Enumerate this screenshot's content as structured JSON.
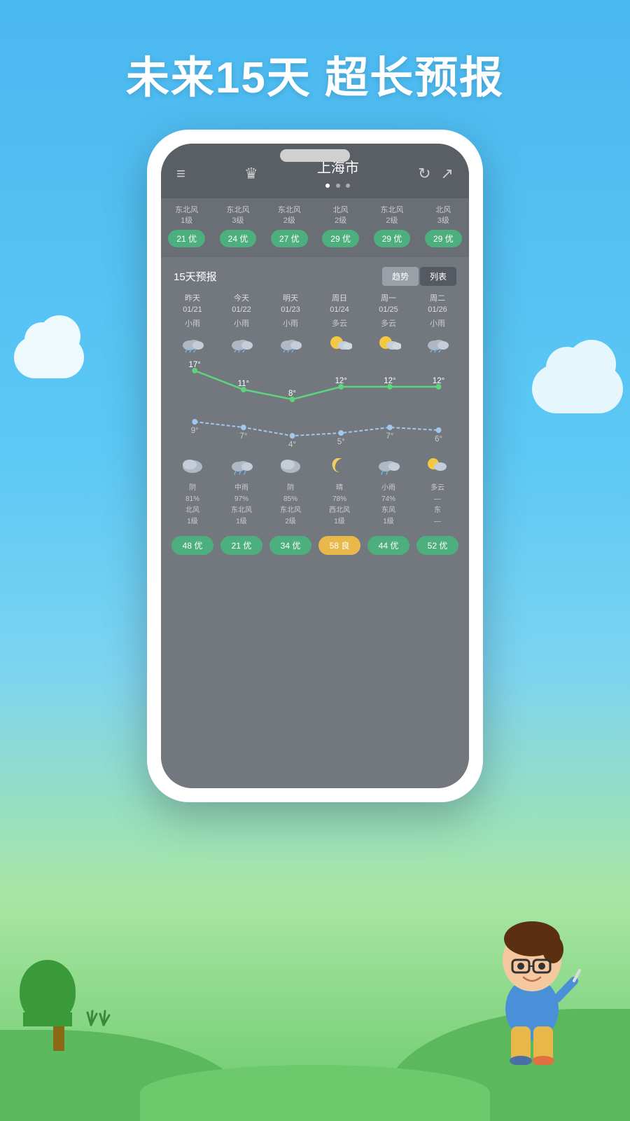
{
  "headline": "未来15天  超长预报",
  "phone": {
    "header": {
      "city": "上海市",
      "menu_icon": "≡",
      "crown_icon": "♛",
      "refresh_icon": "↻",
      "share_icon": "↗"
    },
    "air_quality": [
      {
        "wind": "东北风\n1级",
        "aqi": "21 优",
        "type": "good"
      },
      {
        "wind": "东北风\n3级",
        "aqi": "24 优",
        "type": "good"
      },
      {
        "wind": "东北风\n2级",
        "aqi": "27 优",
        "type": "good"
      },
      {
        "wind": "北风\n2级",
        "aqi": "29 优",
        "type": "good"
      },
      {
        "wind": "东北风\n2级",
        "aqi": "29 优",
        "type": "good"
      },
      {
        "wind": "北风\n3级",
        "aqi": "29 优",
        "type": "good"
      }
    ],
    "forecast_title": "15天预报",
    "forecast_buttons": [
      "趋势",
      "列表"
    ],
    "days": [
      {
        "label": "昨天",
        "date": "01/21",
        "weather": "小雨",
        "icon": "🌧",
        "high": "17°",
        "low": "9°",
        "night_icon": "☁",
        "night_weather": "阴",
        "humidity": "81%",
        "wind": "北风\n1级",
        "aqi": "48 优",
        "aqi_type": "good"
      },
      {
        "label": "今天",
        "date": "01/22",
        "weather": "小雨",
        "icon": "🌧",
        "high": "11°",
        "low": "7°",
        "night_icon": "🌧",
        "night_weather": "中雨",
        "humidity": "97%",
        "wind": "东北风\n1级",
        "aqi": "21 优",
        "aqi_type": "good"
      },
      {
        "label": "明天",
        "date": "01/23",
        "weather": "小雨",
        "icon": "🌧",
        "high": "8°",
        "low": "4°",
        "night_icon": "☁",
        "night_weather": "阴",
        "humidity": "85%",
        "wind": "东北风\n2级",
        "aqi": "34 优",
        "aqi_type": "good"
      },
      {
        "label": "周日",
        "date": "01/24",
        "weather": "多云",
        "icon": "⛅",
        "high": "12°",
        "low": "5°",
        "night_icon": "🌙",
        "night_weather": "晴",
        "humidity": "78%",
        "wind": "西北风\n1级",
        "aqi": "58 良",
        "aqi_type": "moderate"
      },
      {
        "label": "周一",
        "date": "01/25",
        "weather": "多云",
        "icon": "⛅",
        "high": "12°",
        "low": "7°",
        "night_icon": "☁",
        "night_weather": "小雨",
        "humidity": "74%",
        "wind": "东风\n1级",
        "aqi": "44 优",
        "aqi_type": "good"
      },
      {
        "label": "周二",
        "date": "01/26",
        "weather": "小雨",
        "icon": "🌧",
        "high": "12°",
        "low": "6°",
        "night_icon": "⛅",
        "night_weather": "多云",
        "humidity": "—",
        "wind": "东\n—",
        "aqi": "52 优",
        "aqi_type": "good"
      }
    ],
    "chart": {
      "high_temps": [
        17,
        11,
        8,
        12,
        12,
        12
      ],
      "low_temps": [
        9,
        7,
        4,
        5,
        7,
        6
      ]
    }
  },
  "colors": {
    "sky_top": "#4ab8f0",
    "sky_bottom": "#7dd4f0",
    "grass": "#5cb85c",
    "app_bg": "#6a6e75",
    "aqi_good": "#4caf7d",
    "aqi_moderate": "#e8b84b"
  }
}
